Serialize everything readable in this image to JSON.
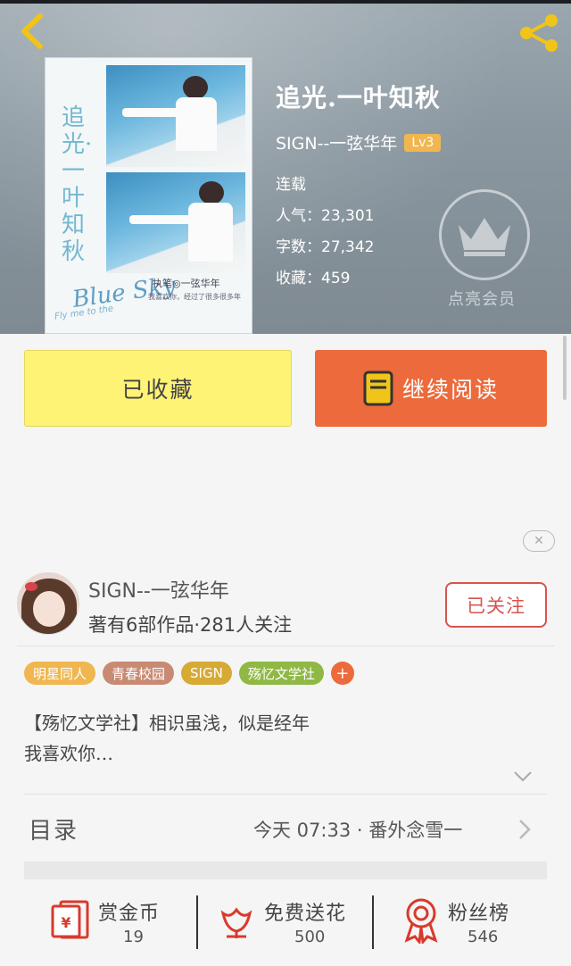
{
  "book": {
    "title": "追光.一叶知秋",
    "author": "SIGN--一弦华年",
    "level": "Lv3",
    "status": "连载",
    "popularity_label": "人气：",
    "popularity": "23,301",
    "words_label": "字数：",
    "words": "27,342",
    "favorites_label": "收藏：",
    "favorites": "459"
  },
  "cover": {
    "vertical_text": "追光·一叶知秋",
    "english": "Blue Sky",
    "english_sub": "Fly me to the",
    "signature": "执笔◎一弦华年",
    "small_text": "我喜欢你，经过了很多很多年"
  },
  "vip": {
    "label": "点亮会员"
  },
  "actions": {
    "collected_label": "已收藏",
    "continue_label": "继续阅读"
  },
  "author_card": {
    "name": "SIGN--一弦华年",
    "stats": "著有6部作品·281人关注",
    "follow_label": "已关注"
  },
  "tags": [
    {
      "label": "明星同人",
      "color": "#f0b64f"
    },
    {
      "label": "青春校园",
      "color": "#c98a73"
    },
    {
      "label": "SIGN",
      "color": "#d7a935"
    },
    {
      "label": "殇忆文学社",
      "color": "#8fb845"
    }
  ],
  "tag_add_label": "+",
  "description": {
    "line1": "【殇忆文学社】相识虽浅，似是经年",
    "line2": "我喜欢你…"
  },
  "toc": {
    "label": "目录",
    "latest": "今天 07:33 · 番外念雪一"
  },
  "bottom": {
    "reward": {
      "label": "赏金币",
      "count": "19"
    },
    "flowers": {
      "label": "免费送花",
      "count": "500"
    },
    "fans": {
      "label": "粉丝榜",
      "count": "546"
    }
  },
  "colors": {
    "accent": "#ec6a3b",
    "collected_bg": "#fff376",
    "follow": "#d9534f",
    "lv_badge": "#f0b64f"
  }
}
